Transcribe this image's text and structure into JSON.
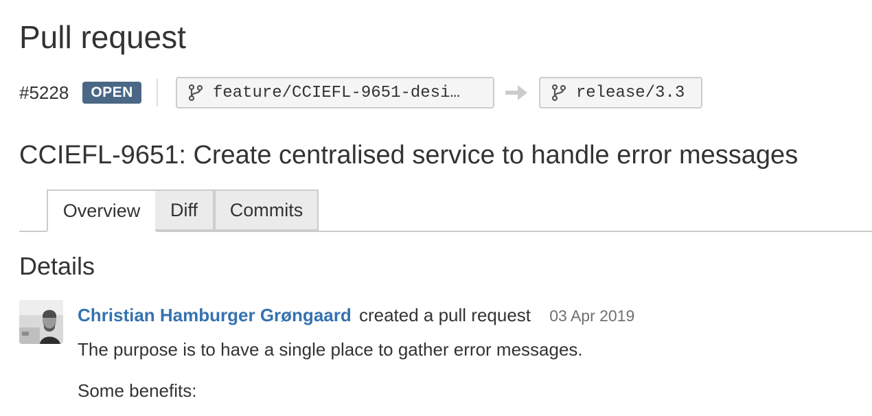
{
  "page": {
    "title": "Pull request"
  },
  "pull_request": {
    "number": "#5228",
    "state": "OPEN",
    "source_branch": "feature/CCIEFL-9651-desi…",
    "target_branch": "release/3.3",
    "title": "CCIEFL-9651: Create centralised service to handle error messages"
  },
  "tabs": [
    {
      "label": "Overview",
      "active": true
    },
    {
      "label": "Diff",
      "active": false
    },
    {
      "label": "Commits",
      "active": false
    }
  ],
  "details": {
    "heading": "Details",
    "activity": {
      "author": "Christian Hamburger Grøngaard",
      "action": "created a pull request",
      "date": "03 Apr 2019"
    },
    "description": [
      "The purpose is to have a single place to gather error messages.",
      "Some benefits:"
    ]
  },
  "colors": {
    "open_badge": "#4a6785",
    "link": "#3572b0"
  },
  "icons": {
    "branch": "branch-icon",
    "arrow": "arrow-right-icon"
  }
}
